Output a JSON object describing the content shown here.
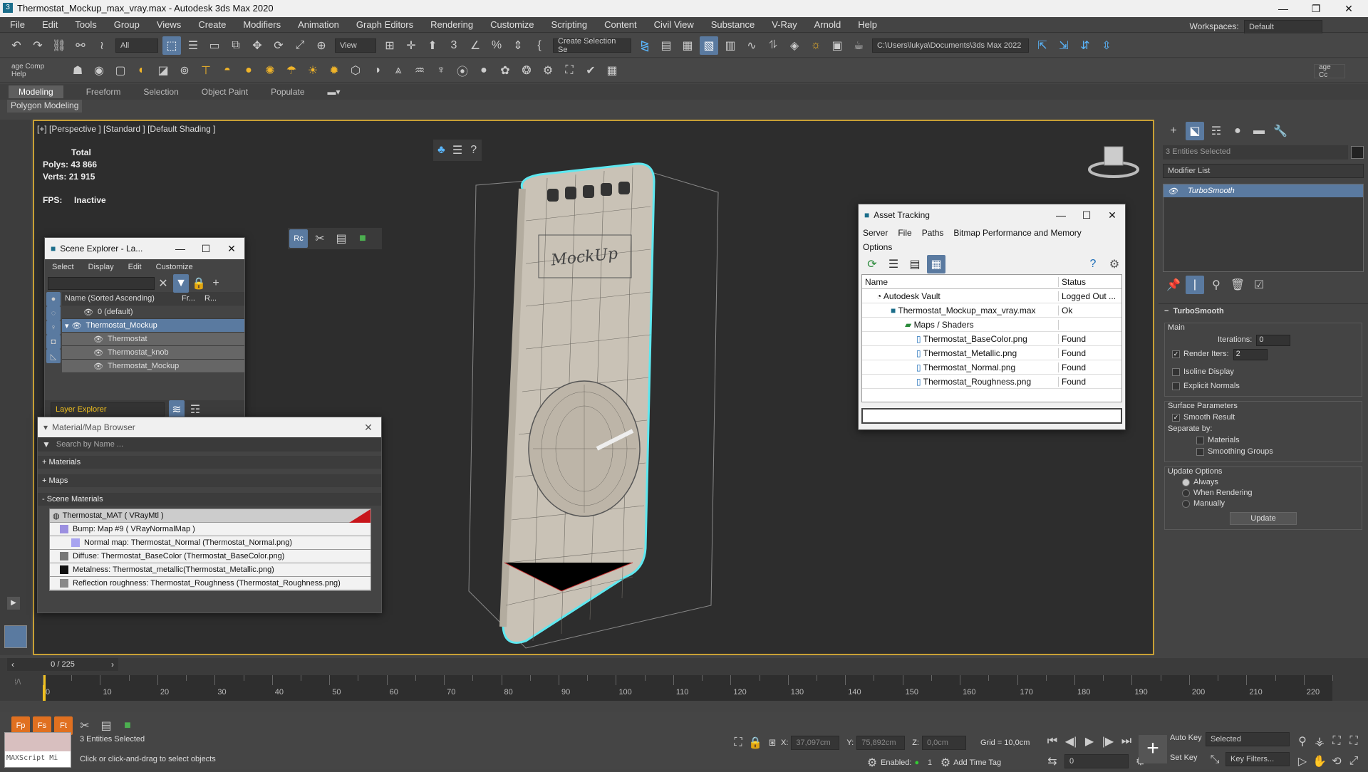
{
  "window": {
    "title": "Thermostat_Mockup_max_vray.max - Autodesk 3ds Max 2020",
    "min": "—",
    "max": "❐",
    "close": "✕"
  },
  "menu": [
    "File",
    "Edit",
    "Tools",
    "Group",
    "Views",
    "Create",
    "Modifiers",
    "Animation",
    "Graph Editors",
    "Rendering",
    "Customize",
    "Scripting",
    "Content",
    "Civil View",
    "Substance",
    "V-Ray",
    "Arnold",
    "Help"
  ],
  "workspace": {
    "label": "Workspaces:",
    "value": "Default"
  },
  "toolbar": {
    "filter": "All",
    "view": "View",
    "selection_set": "Create Selection Se",
    "path": "C:\\Users\\lukya\\Documents\\3ds Max 2022",
    "left_label": "age Comp Help",
    "right_label": "age Cc"
  },
  "ribbon": {
    "tabs": [
      "Modeling",
      "Freeform",
      "Selection",
      "Object Paint",
      "Populate"
    ],
    "sub": "Polygon Modeling"
  },
  "viewport": {
    "label": "[+] [Perspective ] [Standard ] [Default Shading ]",
    "total": "Total",
    "polys_label": "Polys:",
    "polys": "43 866",
    "verts_label": "Verts:",
    "verts": "21 915",
    "fps_label": "FPS:",
    "fps": "Inactive",
    "logo": "MockUp"
  },
  "scene_explorer": {
    "title": "Scene Explorer - La...",
    "menu": [
      "Select",
      "Display",
      "Edit",
      "Customize"
    ],
    "col_name": "Name (Sorted Ascending)",
    "col_fr": "Fr...",
    "col_r": "R...",
    "rows": [
      "0 (default)",
      "Thermostat_Mockup",
      "Thermostat",
      "Thermostat_knob",
      "Thermostat_Mockup"
    ],
    "footer": "Layer Explorer"
  },
  "material_browser": {
    "title": "Material/Map Browser",
    "search": "Search by Name ...",
    "materials": "+ Materials",
    "maps": "+ Maps",
    "scene": "- Scene Materials",
    "items": [
      "Thermostat_MAT  ( VRayMtl )",
      "Bump: Map #9  ( VRayNormalMap )",
      "Normal map: Thermostat_Normal (Thermostat_Normal.png)",
      "Diffuse: Thermostat_BaseColor (Thermostat_BaseColor.png)",
      "Metalness: Thermostat_metallic(Thermostat_Metallic.png)",
      "Reflection roughness: Thermostat_Roughness (Thermostat_Roughness.png)"
    ]
  },
  "asset_tracking": {
    "title": "Asset Tracking",
    "menu": [
      "Server",
      "File",
      "Paths",
      "Bitmap Performance and Memory"
    ],
    "options": "Options",
    "col_name": "Name",
    "col_status": "Status",
    "rows": [
      {
        "name": "Autodesk Vault",
        "status": "Logged Out ..."
      },
      {
        "name": "Thermostat_Mockup_max_vray.max",
        "status": "Ok"
      },
      {
        "name": "Maps / Shaders",
        "status": ""
      },
      {
        "name": "Thermostat_BaseColor.png",
        "status": "Found"
      },
      {
        "name": "Thermostat_Metallic.png",
        "status": "Found"
      },
      {
        "name": "Thermostat_Normal.png",
        "status": "Found"
      },
      {
        "name": "Thermostat_Roughness.png",
        "status": "Found"
      }
    ]
  },
  "command_panel": {
    "selected": "3 Entities Selected",
    "modifier_list": "Modifier List",
    "modifier": "TurboSmooth",
    "rollout": "TurboSmooth",
    "main": "Main",
    "iterations_label": "Iterations:",
    "iterations": "0",
    "render_iters_label": "Render Iters:",
    "render_iters": "2",
    "isoline": "Isoline Display",
    "explicit": "Explicit Normals",
    "surface": "Surface Parameters",
    "smooth": "Smooth Result",
    "separate": "Separate by:",
    "materials": "Materials",
    "smoothing": "Smoothing Groups",
    "update_opts": "Update Options",
    "always": "Always",
    "when_rendering": "When Rendering",
    "manually": "Manually",
    "update": "Update"
  },
  "timeline": {
    "frame": "0 / 225",
    "ticks": [
      "0",
      "10",
      "20",
      "30",
      "40",
      "50",
      "60",
      "70",
      "80",
      "90",
      "100",
      "110",
      "120",
      "130",
      "140",
      "150",
      "160",
      "170",
      "180",
      "190",
      "200",
      "210",
      "220"
    ]
  },
  "status": {
    "entities": "3 Entities Selected",
    "hint": "Click or click-and-drag to select objects",
    "maxscript": "MAXScript Mi",
    "x_label": "X:",
    "x": "37,097cm",
    "y_label": "Y:",
    "y": "75,892cm",
    "z_label": "Z:",
    "z": "0,0cm",
    "grid": "Grid = 10,0cm",
    "enabled": "Enabled:",
    "add_time_tag": "Add Time Tag",
    "auto_key": "Auto Key",
    "set_key": "Set Key",
    "selected": "Selected",
    "key_filters": "Key Filters...",
    "frame_field": "0"
  }
}
